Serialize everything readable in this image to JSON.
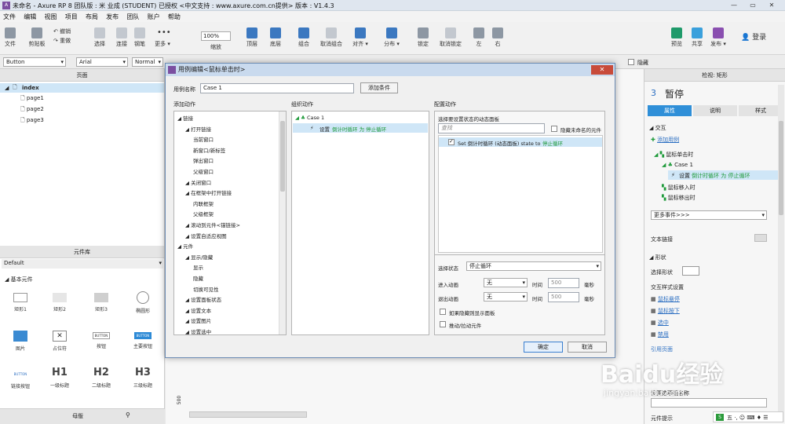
{
  "titlebar": {
    "title": "未命名 - Axure RP 8 团队版 : 米 业成 (STUDENT) 已授权   <中文支持 : www.axure.com.cn提供> 版本 : V1.4.3",
    "logo": "A",
    "minimize": "—",
    "restore": "▭",
    "close": "✕"
  },
  "menu": [
    "文件",
    "编辑",
    "视图",
    "项目",
    "布局",
    "发布",
    "团队",
    "账户",
    "帮助"
  ],
  "toolbar": {
    "file": "文件",
    "clipboard": "剪贴板",
    "undo": "撤销",
    "redo": "重做",
    "select": "选择",
    "connect": "连接",
    "pen": "钢笔",
    "more": "更多 ▾",
    "zoom_value": "100%",
    "zoom_label": "缩放",
    "top": "顶层",
    "bottom": "底层",
    "group": "组合",
    "ungroup": "取消组合",
    "align": "对齐 ▾",
    "distribute": "分布 ▾",
    "lock": "锁定",
    "unlock": "取消锁定",
    "left": "左",
    "right": "右",
    "preview": "预览",
    "share": "共享",
    "publish": "发布 ▾",
    "login": "登录"
  },
  "formatbar": {
    "widget_type": "Button",
    "font": "Arial",
    "style": "Normal",
    "hide_label": "隐藏"
  },
  "pages_panel": {
    "title": "页面",
    "root": "index",
    "pages": [
      "page1",
      "page2",
      "page3"
    ]
  },
  "library_panel": {
    "title": "元件库",
    "library": "Default",
    "section": "基本元件",
    "items": [
      "矩形1",
      "矩形2",
      "矩形3",
      "椭圆形",
      "图片",
      "占位符",
      "按钮",
      "主要按钮",
      "链接按钮",
      "一级标题",
      "二级标题",
      "三级标题"
    ],
    "button_text": "BUTTON",
    "h1": "H1",
    "h2": "H2",
    "h3": "H3"
  },
  "master_panel": {
    "title": "母版"
  },
  "canvas": {
    "ruler_mark": "500"
  },
  "inspector": {
    "title": "检视: 矩形",
    "number": "3",
    "widget_name": "暂停",
    "tabs": [
      "属性",
      "说明",
      "样式"
    ],
    "interaction": "交互",
    "add_case": "添加用例",
    "event_click": "鼠标单击时",
    "case": "Case 1",
    "action_prefix": "设置",
    "action_detail": "倒计时循环 为 停止循环",
    "event_enter": "鼠标移入时",
    "event_leave": "鼠标移出时",
    "more_events": "更多事件>>>",
    "text_link": "文本链接",
    "shape": "形状",
    "select_shape": "选择形状",
    "interaction_style": "交互样式设置",
    "hover": "鼠标悬停",
    "pressed": "鼠标按下",
    "selected": "选中",
    "disabled": "禁用",
    "reference_page": "引用页面",
    "set_option": "设置选项组名称",
    "tooltip": "元件提示"
  },
  "dialog": {
    "title": "用例编辑<鼠标单击时>",
    "close": "✕",
    "case_name_label": "用例名称",
    "case_name_value": "Case 1",
    "add_condition": "添加条件",
    "col_add": "添加动作",
    "col_organize": "组织动作",
    "col_configure": "配置动作",
    "actions_tree": [
      {
        "text": "链接",
        "level": 0
      },
      {
        "text": "打开链接",
        "level": 1
      },
      {
        "text": "当前窗口",
        "level": 2
      },
      {
        "text": "新窗口/新标签",
        "level": 2
      },
      {
        "text": "弹出窗口",
        "level": 2
      },
      {
        "text": "父级窗口",
        "level": 2
      },
      {
        "text": "关闭窗口",
        "level": 1
      },
      {
        "text": "在框架中打开链接",
        "level": 1
      },
      {
        "text": "内联框架",
        "level": 2
      },
      {
        "text": "父级框架",
        "level": 2
      },
      {
        "text": "滚动到元件<锚链接>",
        "level": 1
      },
      {
        "text": "设置自适应视图",
        "level": 1
      },
      {
        "text": "元件",
        "level": 0
      },
      {
        "text": "显示/隐藏",
        "level": 1
      },
      {
        "text": "显示",
        "level": 2
      },
      {
        "text": "隐藏",
        "level": 2
      },
      {
        "text": "切换可见性",
        "level": 2
      },
      {
        "text": "设置面板状态",
        "level": 1
      },
      {
        "text": "设置文本",
        "level": 1
      },
      {
        "text": "设置图片",
        "level": 1
      },
      {
        "text": "设置选中",
        "level": 1
      }
    ],
    "organize_case": "Case 1",
    "organize_action_prefix": "设置",
    "organize_action_detail": "倒计时循环 为 停止循环",
    "config_title": "选择要设置状态的动态面板",
    "search_placeholder": "查找",
    "hide_unnamed": "隐藏未命名的元件",
    "panel_row_prefix": "Set 倒计时循环 (动态面板) state to",
    "panel_row_state": "停止循环",
    "select_state_label": "选择状态",
    "select_state_value": "停止循环",
    "enter_anim_label": "进入动画",
    "exit_anim_label": "退出动画",
    "anim_value": "无",
    "time_label": "时间",
    "time_value": "500",
    "ms": "毫秒",
    "show_if_hidden": "如果隐藏则显示面板",
    "push_pull": "推动/拉动元件",
    "ok": "确定",
    "cancel": "取消"
  },
  "watermark": {
    "text": "Baidu经验",
    "sub": "jingyan.baidu.com"
  },
  "ime": {
    "text": "五 ·, ☺ ⌨ ♦ ☰"
  }
}
